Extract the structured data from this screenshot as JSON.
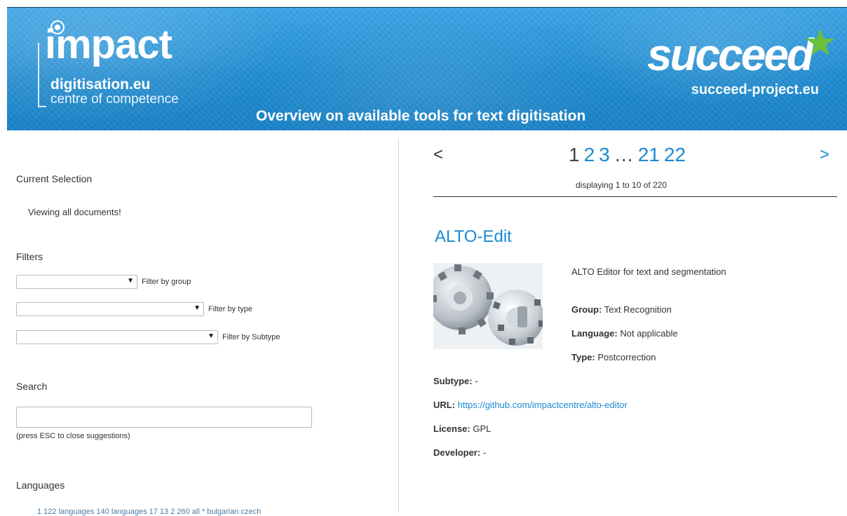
{
  "header": {
    "impact_word": "impact",
    "impact_domain": "digitisation.eu",
    "impact_sub": "centre of competence",
    "succeed_word": "succeed",
    "succeed_domain": "succeed-project.eu",
    "title": "Overview on available tools for text digitisation"
  },
  "sidebar": {
    "current_selection_title": "Current Selection",
    "viewing_text": "Viewing all documents!",
    "filters_title": "Filters",
    "filters": [
      {
        "label": "Filter by group",
        "value": ""
      },
      {
        "label": "Filter by type",
        "value": ""
      },
      {
        "label": "Filter by Subtype",
        "value": ""
      }
    ],
    "search_title": "Search",
    "search_value": "",
    "search_hint": "(press ESC to close suggestions)",
    "languages_title": "Languages",
    "languages_links": "1 122 languages 140 languages 17 13 2 260 all * bulgarian czech"
  },
  "pagination": {
    "prev": "<",
    "next": ">",
    "current": "1",
    "pages": [
      "2",
      "3"
    ],
    "ellipsis": "…",
    "last_pages": [
      "21",
      "22"
    ],
    "displaying": "displaying 1 to 10 of 220"
  },
  "tool": {
    "title": "ALTO-Edit",
    "description": "ALTO Editor for text and segmentation",
    "group_label": "Group:",
    "group": "Text Recognition",
    "language_label": "Language:",
    "language": "Not applicable",
    "type_label": "Type:",
    "type": "Postcorrection",
    "subtype_label": "Subtype:",
    "subtype": "-",
    "url_label": "URL:",
    "url": "https://github.com/impactcentre/alto-editor",
    "license_label": "License:",
    "license": "GPL",
    "developer_label": "Developer:",
    "developer": "-"
  },
  "colors": {
    "header_blue": "#1f8fd4",
    "link_blue": "#1a8ad0",
    "star_green": "#6cbf3a"
  }
}
